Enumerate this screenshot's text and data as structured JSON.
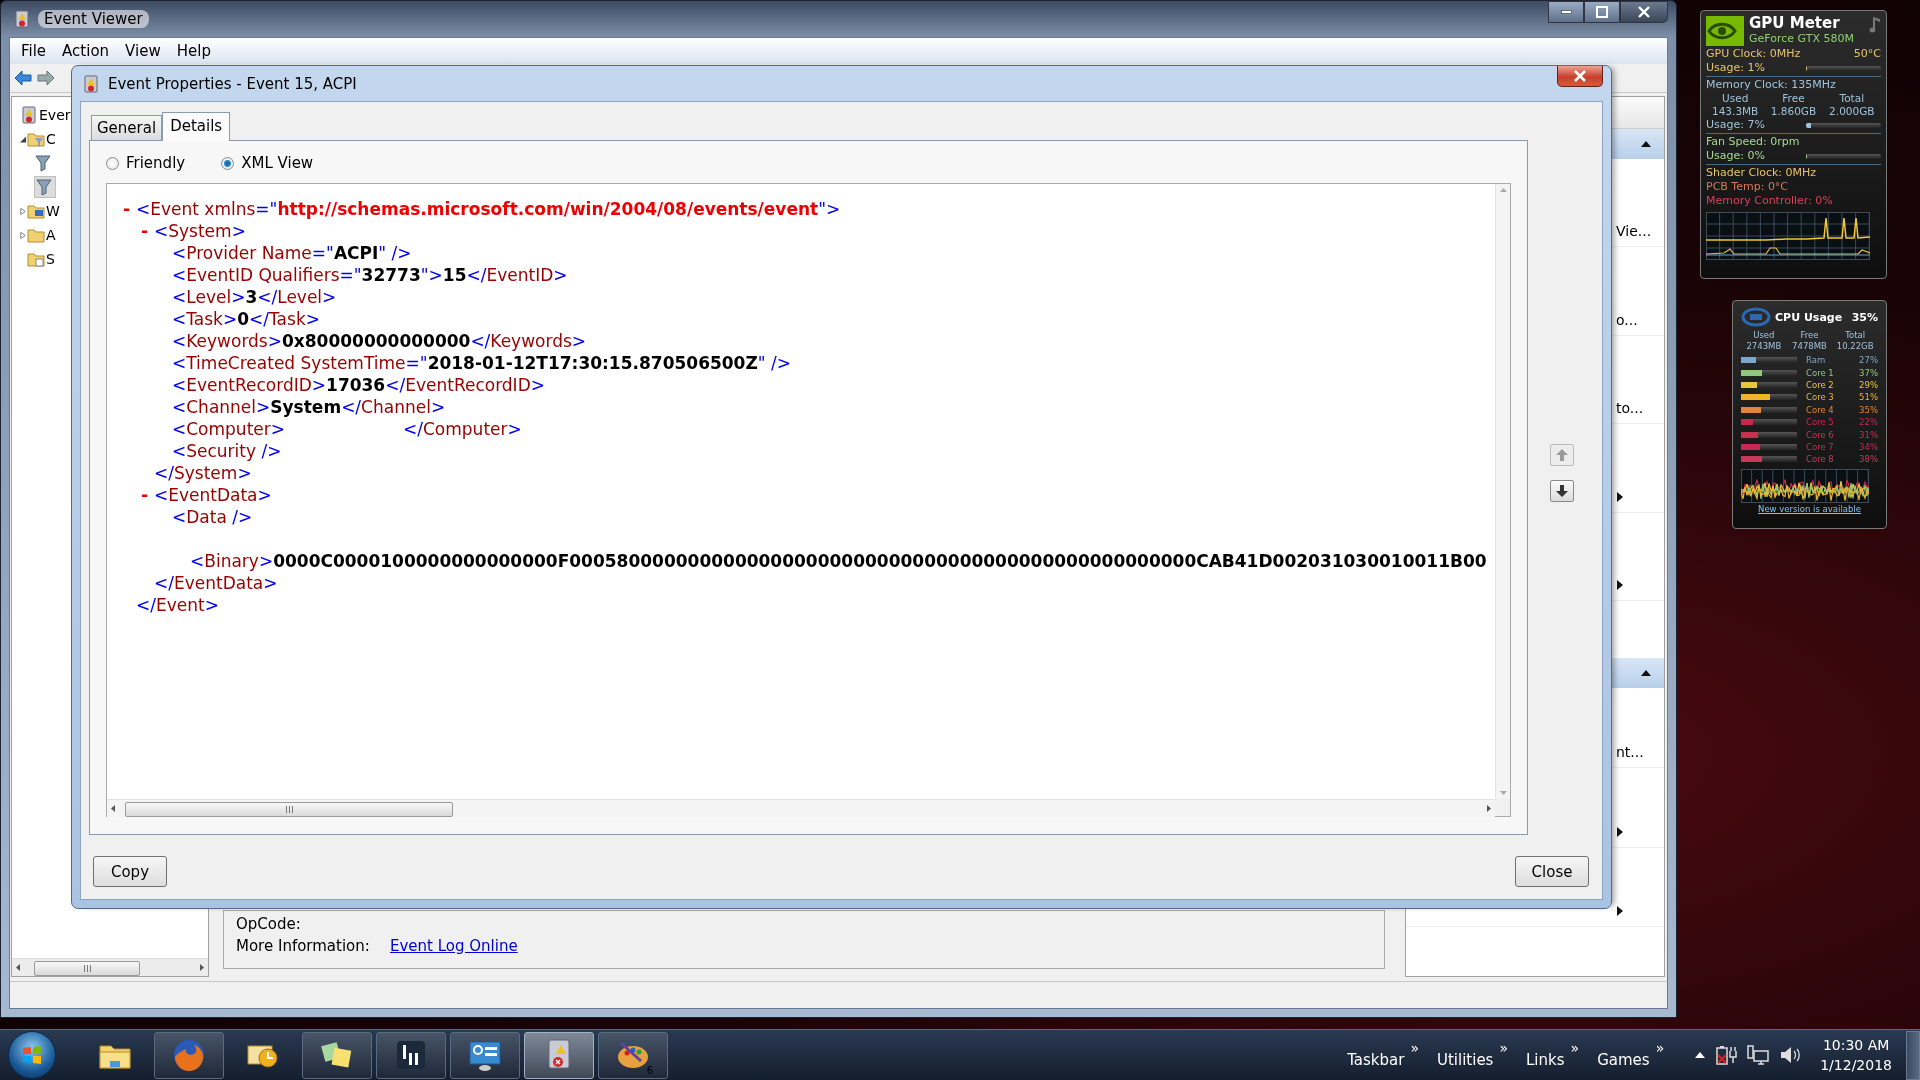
{
  "event_viewer": {
    "title": "Event Viewer",
    "menu": [
      {
        "label": "File"
      },
      {
        "label": "Action"
      },
      {
        "label": "View"
      },
      {
        "label": "Help"
      }
    ],
    "tree": [
      {
        "label": "Ever",
        "kind": "root",
        "selected": false,
        "children": [
          {
            "label": "C",
            "kind": "filter_folder",
            "selected": false,
            "expanded": true,
            "children": [
              {
                "kind": "filter",
                "selected": false
              },
              {
                "kind": "filter",
                "selected": true
              }
            ]
          },
          {
            "label": "W",
            "kind": "logs_folder",
            "selected": false,
            "expanded": false
          },
          {
            "label": "A",
            "kind": "folder",
            "selected": false,
            "expanded": false
          },
          {
            "label": "S",
            "kind": "subscriptions",
            "selected": false
          }
        ]
      }
    ],
    "details": [
      {
        "label": "OpCode:"
      },
      {
        "label": "More Information:",
        "link": "Event Log Online "
      }
    ],
    "actions": [
      {
        "expanded": true,
        "items": [
          {
            "text": "Vie...",
            "submenu": false
          },
          {
            "text": "o...",
            "submenu": false
          },
          {
            "text": "to...",
            "submenu": false
          },
          {
            "submenu": true
          },
          {
            "submenu": true
          }
        ]
      },
      {
        "expanded": true,
        "items": [
          {
            "text": "nt...",
            "submenu": false
          },
          {
            "submenu": true
          },
          {
            "submenu": true
          }
        ]
      }
    ]
  },
  "dialog": {
    "title": "Event Properties - Event 15, ACPI",
    "tabs": [
      {
        "label": "General",
        "selected": false
      },
      {
        "label": "Details",
        "selected": true
      }
    ],
    "views": [
      {
        "label": "Friendly",
        "selected": false
      },
      {
        "label": "XML View",
        "selected": true
      }
    ],
    "xml": {
      "toggle": "-",
      "open": [
        {
          "kind": "punct",
          "text": "<"
        },
        {
          "kind": "name",
          "text": "Event xmlns"
        },
        {
          "kind": "punct",
          "text": "=\""
        },
        {
          "kind": "ns",
          "text": "http://schemas.microsoft.com/win/2004/08/events/event"
        },
        {
          "kind": "punct",
          "text": "\">"
        }
      ],
      "children": [
        {
          "toggle": "-",
          "open": [
            {
              "kind": "punct",
              "text": "<"
            },
            {
              "kind": "name",
              "text": "System"
            },
            {
              "kind": "punct",
              "text": ">"
            }
          ],
          "children": [
            {
              "open": [
                {
                  "kind": "punct",
                  "text": "<"
                },
                {
                  "kind": "name",
                  "text": "Provider Name"
                },
                {
                  "kind": "punct",
                  "text": "=\""
                },
                {
                  "kind": "value",
                  "text": "ACPI"
                },
                {
                  "kind": "punct",
                  "text": "\" />"
                }
              ]
            },
            {
              "open": [
                {
                  "kind": "punct",
                  "text": "<"
                },
                {
                  "kind": "name",
                  "text": "EventID Qualifiers"
                },
                {
                  "kind": "punct",
                  "text": "=\""
                },
                {
                  "kind": "value",
                  "text": "32773"
                },
                {
                  "kind": "punct",
                  "text": "\">"
                },
                {
                  "kind": "value",
                  "text": "15"
                },
                {
                  "kind": "punct",
                  "text": "</"
                },
                {
                  "kind": "name",
                  "text": "EventID"
                },
                {
                  "kind": "punct",
                  "text": ">"
                }
              ]
            },
            {
              "open": [
                {
                  "kind": "punct",
                  "text": "<"
                },
                {
                  "kind": "name",
                  "text": "Level"
                },
                {
                  "kind": "punct",
                  "text": ">"
                },
                {
                  "kind": "value",
                  "text": "3"
                },
                {
                  "kind": "punct",
                  "text": "</"
                },
                {
                  "kind": "name",
                  "text": "Level"
                },
                {
                  "kind": "punct",
                  "text": ">"
                }
              ]
            },
            {
              "open": [
                {
                  "kind": "punct",
                  "text": "<"
                },
                {
                  "kind": "name",
                  "text": "Task"
                },
                {
                  "kind": "punct",
                  "text": ">"
                },
                {
                  "kind": "value",
                  "text": "0"
                },
                {
                  "kind": "punct",
                  "text": "</"
                },
                {
                  "kind": "name",
                  "text": "Task"
                },
                {
                  "kind": "punct",
                  "text": ">"
                }
              ]
            },
            {
              "open": [
                {
                  "kind": "punct",
                  "text": "<"
                },
                {
                  "kind": "name",
                  "text": "Keywords"
                },
                {
                  "kind": "punct",
                  "text": ">"
                },
                {
                  "kind": "value",
                  "text": "0x80000000000000"
                },
                {
                  "kind": "punct",
                  "text": "</"
                },
                {
                  "kind": "name",
                  "text": "Keywords"
                },
                {
                  "kind": "punct",
                  "text": ">"
                }
              ]
            },
            {
              "open": [
                {
                  "kind": "punct",
                  "text": "<"
                },
                {
                  "kind": "name",
                  "text": "TimeCreated SystemTime"
                },
                {
                  "kind": "punct",
                  "text": "=\""
                },
                {
                  "kind": "value",
                  "text": "2018-01-12T17:30:15.870506500Z"
                },
                {
                  "kind": "punct",
                  "text": "\" />"
                }
              ]
            },
            {
              "open": [
                {
                  "kind": "punct",
                  "text": "<"
                },
                {
                  "kind": "name",
                  "text": "EventRecordID"
                },
                {
                  "kind": "punct",
                  "text": ">"
                },
                {
                  "kind": "value",
                  "text": "17036"
                },
                {
                  "kind": "punct",
                  "text": "</"
                },
                {
                  "kind": "name",
                  "text": "EventRecordID"
                },
                {
                  "kind": "punct",
                  "text": ">"
                }
              ]
            },
            {
              "open": [
                {
                  "kind": "punct",
                  "text": "<"
                },
                {
                  "kind": "name",
                  "text": "Channel"
                },
                {
                  "kind": "punct",
                  "text": ">"
                },
                {
                  "kind": "value",
                  "text": "System"
                },
                {
                  "kind": "punct",
                  "text": "</"
                },
                {
                  "kind": "name",
                  "text": "Channel"
                },
                {
                  "kind": "punct",
                  "text": ">"
                }
              ]
            },
            {
              "open": [
                {
                  "kind": "punct",
                  "text": "<"
                },
                {
                  "kind": "name",
                  "text": "Computer"
                },
                {
                  "kind": "punct",
                  "text": ">"
                },
                {
                  "kind": "blank"
                },
                {
                  "kind": "punct",
                  "text": "</"
                },
                {
                  "kind": "name",
                  "text": "Computer"
                },
                {
                  "kind": "punct",
                  "text": ">"
                }
              ]
            },
            {
              "open": [
                {
                  "kind": "punct",
                  "text": "<"
                },
                {
                  "kind": "name",
                  "text": "Security"
                },
                {
                  "kind": "punct",
                  "text": " />"
                }
              ]
            }
          ],
          "close": [
            {
              "kind": "punct",
              "text": "</"
            },
            {
              "kind": "name",
              "text": "System"
            },
            {
              "kind": "punct",
              "text": ">"
            }
          ]
        },
        {
          "toggle": "-",
          "open": [
            {
              "kind": "punct",
              "text": "<"
            },
            {
              "kind": "name",
              "text": "EventData"
            },
            {
              "kind": "punct",
              "text": ">"
            }
          ],
          "children": [
            {
              "open": [
                {
                  "kind": "punct",
                  "text": "<"
                },
                {
                  "kind": "name",
                  "text": "Data"
                },
                {
                  "kind": "punct",
                  "text": " />"
                }
              ]
            },
            {
              "separated": true,
              "open": [
                {
                  "kind": "punct",
                  "text": "<"
                },
                {
                  "kind": "name",
                  "text": "Binary"
                },
                {
                  "kind": "punct",
                  "text": ">"
                },
                {
                  "kind": "value",
                  "text": "0000C0000100000000000000F00058000000000000000000000000000000000000000000000000CAB41D002031030010011B00"
                }
              ]
            }
          ],
          "close": [
            {
              "kind": "punct",
              "text": "</"
            },
            {
              "kind": "name",
              "text": "EventData"
            },
            {
              "kind": "punct",
              "text": ">"
            }
          ]
        }
      ],
      "close": [
        {
          "kind": "punct",
          "text": "</"
        },
        {
          "kind": "name",
          "text": "Event"
        },
        {
          "kind": "punct",
          "text": ">"
        }
      ]
    },
    "nav": [
      {
        "kind": "up",
        "disabled": true
      },
      {
        "kind": "down",
        "disabled": false
      }
    ],
    "buttons": [
      {
        "label": "Copy"
      },
      {
        "label": "Close"
      }
    ]
  },
  "gpu_meter": {
    "title": "GPU Meter",
    "subtitle": "GeForce GTX 580M",
    "sections": [
      {
        "rows": [
          {
            "kind": "pair",
            "color": "#e8c468",
            "left": "GPU Clock: 0MHz",
            "right": "50°C"
          },
          {
            "kind": "bar",
            "color": "#e8c468",
            "label": "Usage: 1%",
            "level": 0.01
          }
        ]
      },
      {
        "rows": [
          {
            "kind": "text",
            "color": "#9ec3dc",
            "text": "Memory Clock: 135MHz"
          },
          {
            "kind": "columns",
            "color": "#9ec3dc",
            "headers": [
              "Used",
              "Free",
              "Total"
            ],
            "values": [
              "143.3MB",
              "1.860GB",
              "2.000GB"
            ]
          },
          {
            "kind": "bar",
            "color": "#9ec3dc",
            "label": "Usage: 7%",
            "level": 0.07
          }
        ]
      },
      {
        "rows": [
          {
            "kind": "text",
            "color": "#a8d890",
            "text": "Fan Speed: 0rpm"
          },
          {
            "kind": "bar",
            "color": "#a8d890",
            "label": "Usage: 0%",
            "level": 0
          }
        ]
      },
      {
        "rows": [
          {
            "kind": "text",
            "color": "#e8c468",
            "text": "Shader Clock: 0MHz"
          },
          {
            "kind": "text",
            "color": "#d87858",
            "text": "PCB Temp: 0°C"
          },
          {
            "kind": "text",
            "color": "#d8405a",
            "text": "Memory Controller: 0%"
          }
        ]
      }
    ]
  },
  "cpu_usage": {
    "title": "CPU Usage",
    "value": "35%",
    "headers": [
      "Used",
      "Free",
      "Total"
    ],
    "values": [
      "2743MB",
      "7478MB",
      "10.22GB"
    ],
    "bars": [
      {
        "label": "Ram",
        "reading": "27%",
        "level": 0.27,
        "color": "#7aa8cc"
      },
      {
        "label": "Core 1",
        "reading": "37%",
        "level": 0.37,
        "color": "#8fc87a"
      },
      {
        "label": "Core 2",
        "reading": "29%",
        "level": 0.29,
        "color": "#e8c83a"
      },
      {
        "label": "Core 3",
        "reading": "51%",
        "level": 0.51,
        "color": "#f0b428"
      },
      {
        "label": "Core 4",
        "reading": "35%",
        "level": 0.35,
        "color": "#e0873a"
      },
      {
        "label": "Core 5",
        "reading": "22%",
        "level": 0.22,
        "color": "#c8284a"
      },
      {
        "label": "Core 6",
        "reading": "31%",
        "level": 0.31,
        "color": "#c83050"
      },
      {
        "label": "Core 7",
        "reading": "34%",
        "level": 0.34,
        "color": "#c82858"
      },
      {
        "label": "Core 8",
        "reading": "38%",
        "level": 0.38,
        "color": "#c83858"
      }
    ],
    "link": "New version is available"
  },
  "taskbar": {
    "apps": [
      {
        "kind": "folder",
        "running": false,
        "selected": false
      },
      {
        "kind": "browser",
        "running": true,
        "selected": false
      },
      {
        "kind": "mail",
        "running": false,
        "selected": false
      },
      {
        "kind": "notes",
        "running": true,
        "selected": false
      },
      {
        "kind": "meter",
        "running": true,
        "selected": false
      },
      {
        "kind": "panel",
        "running": true,
        "selected": false
      },
      {
        "kind": "eventlog",
        "running": true,
        "selected": true
      },
      {
        "kind": "palette",
        "running": true,
        "selected": false,
        "badge": "6"
      }
    ],
    "toolbars": [
      {
        "label": "Taskbar",
        "chevron": "»"
      },
      {
        "label": "Utilities",
        "chevron": "»"
      },
      {
        "label": "Links",
        "chevron": "»"
      },
      {
        "label": "Games",
        "chevron": "»"
      }
    ],
    "clock": {
      "time": "10:30 AM",
      "date": "1/12/2018"
    }
  }
}
